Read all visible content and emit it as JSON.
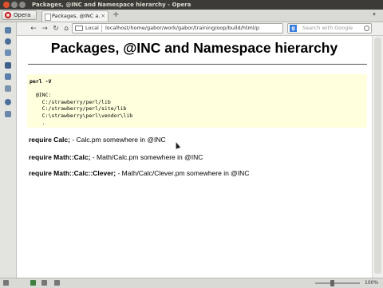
{
  "window": {
    "title": "Packages, @INC and Namespace hierarchy - Opera"
  },
  "tabbar": {
    "menu_label": "Opera",
    "tab_label": "Packages, @INC a...",
    "close_glyph": "×",
    "new_tab_glyph": "+",
    "tab_menu_glyph": "▾"
  },
  "addressbar": {
    "back_glyph": "←",
    "forward_glyph": "→",
    "reload_glyph": "↻",
    "home_glyph": "⌂",
    "local_label": "Local",
    "url": "localhost/home/gabor/work/gabor/training/oop/build/html/p",
    "search_placeholder": "Search with Google",
    "search_engine": "g"
  },
  "page": {
    "heading": "Packages, @INC and Namespace hierarchy",
    "code_lines": [
      "perl -V",
      "",
      "  @INC:",
      "    C:/strawberry/perl/lib",
      "    C:/strawberry/perl/site/lib",
      "    C:\\strawberry\\perl\\vendor\\lib",
      "    ."
    ],
    "requires": [
      {
        "code": "require Calc;",
        "text": " - Calc.pm somewhere in @INC"
      },
      {
        "code": "require Math::Calc;",
        "text": " - Math/Calc.pm somewhere in @INC"
      },
      {
        "code": "require Math::Calc::Clever;",
        "text": " - Math/Calc/Clever.pm somewhere in @INC"
      }
    ]
  },
  "statusbar": {
    "zoom": "100%"
  },
  "colors": {
    "code_background": "#ffffdd",
    "titlebar": "#3c3b37",
    "opera_red": "#d01010"
  },
  "icons": {
    "sidebar": [
      "bookmarks-icon",
      "speed-dial-icon",
      "downloads-icon",
      "notes-icon",
      "history-icon",
      "panels-icon",
      "settings-icon",
      "unite-icon"
    ],
    "status": [
      "panel-toggle-icon",
      "turbo-icon",
      "page-icon",
      "view-icon"
    ]
  }
}
